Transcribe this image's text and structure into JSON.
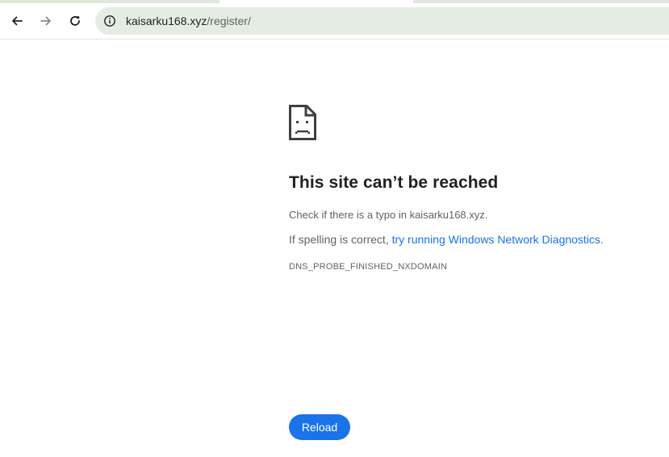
{
  "browser": {
    "url_host": "kaisarku168.xyz",
    "url_path": "/register/",
    "icons": {
      "back": "back-arrow-icon",
      "forward": "forward-arrow-icon",
      "reload": "reload-icon",
      "site_info": "info-icon"
    }
  },
  "error_page": {
    "icon": "sad-document-icon",
    "title": "This site can’t be reached",
    "check_typo": "Check if there is a typo in kaisarku168.xyz.",
    "spelling_prefix": "If spelling is correct, ",
    "diagnostics_link": "try running Windows Network Diagnostics",
    "spelling_suffix": ".",
    "error_code": "DNS_PROBE_FINISHED_NXDOMAIN",
    "reload_label": "Reload"
  },
  "colors": {
    "accent": "#1a73e8",
    "omnibox_bg": "#e5ece1",
    "title_text": "#202124",
    "body_text": "#5f6368"
  }
}
